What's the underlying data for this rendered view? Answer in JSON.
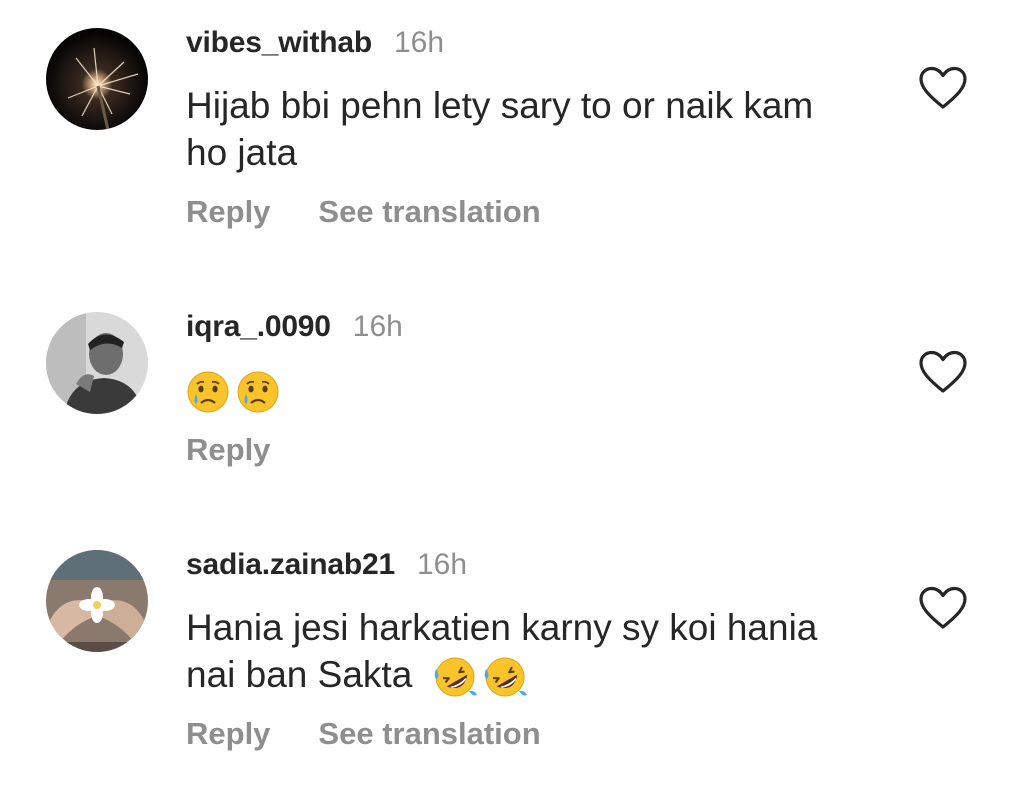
{
  "comments": [
    {
      "username": "vibes_withab",
      "time": "16h",
      "text_lines": [
        "Hijab bbi pehn lety sary to or naik kam",
        "ho jata"
      ],
      "actions": {
        "reply": "Reply",
        "translate": "See translation"
      },
      "avatar": "sparkler-avatar",
      "like_icon": "heart-outline-icon"
    },
    {
      "username": "iqra_.0090",
      "time": "16h",
      "emojis": [
        "crying-face-emoji",
        "crying-face-emoji"
      ],
      "actions": {
        "reply": "Reply"
      },
      "avatar": "person-photo-avatar",
      "like_icon": "heart-outline-icon"
    },
    {
      "username": "sadia.zainab21",
      "time": "16h",
      "text_lines": [
        "Hania jesi harkatien karny sy koi hania",
        "nai ban Sakta"
      ],
      "emojis": [
        "rolling-on-floor-laughing-emoji",
        "rolling-on-floor-laughing-emoji"
      ],
      "actions": {
        "reply": "Reply",
        "translate": "See translation"
      },
      "avatar": "flower-in-hands-avatar",
      "like_icon": "heart-outline-icon"
    }
  ],
  "colors": {
    "username": "#262626",
    "text": "#262626",
    "secondary": "#8e8e8e",
    "background": "#ffffff"
  }
}
